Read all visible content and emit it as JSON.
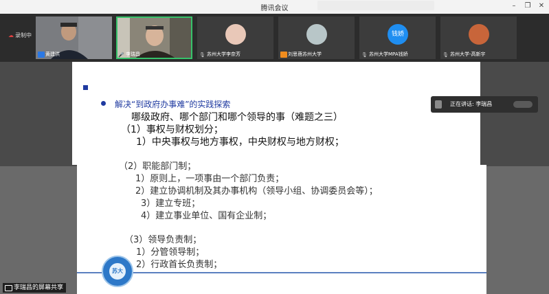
{
  "window": {
    "title": "腾讯会议",
    "controls": {
      "minimize": "–",
      "maximize": "❐",
      "close": "✕"
    }
  },
  "recording": {
    "label": "录制中"
  },
  "participants": [
    {
      "name": "黄建洪",
      "host": true,
      "avatar": "video"
    },
    {
      "name": "李瑞昌",
      "active": true,
      "avatar": "video"
    },
    {
      "name": "苏州大学李奈芳",
      "avatar": "photo"
    },
    {
      "name": "刘思蓓苏州大学",
      "host": true,
      "avatar": "photo"
    },
    {
      "name": "苏州大学MPA钱娇",
      "avatar_text": "钱娇"
    },
    {
      "name": "苏州大学-高新宇",
      "avatar": "photo"
    }
  ],
  "speaker": {
    "label": "正在讲话: 李瑞昌"
  },
  "slide": {
    "heading": "解决“到政府办事难”的实践探索",
    "line1": "哪级政府、哪个部门和哪个领导的事（难题之三）",
    "line2": "（1）事权与财权划分；",
    "line3": "1）中央事权与地方事权，中央财权与地方财权；",
    "line4": "（2）职能部门制；",
    "line5": "1）原则上，一项事由一个部门负责；",
    "line6": "2）建立协调机制及其办事机构（领导小组、协调委员会等）；",
    "line7": "3）建立专班；",
    "line8": "4）建立事业单位、国有企业制；",
    "line9": "（3）领导负责制；",
    "line10": "1）分管领导制；",
    "line11": "2）行政首长负责制；",
    "logo_text": "苏大"
  },
  "share": {
    "label": "李瑞昌的屏幕共享"
  },
  "colors": {
    "heading_blue": "#1f3aa0",
    "active_green": "#36c36a",
    "accent_blue": "#1f8ef1"
  }
}
